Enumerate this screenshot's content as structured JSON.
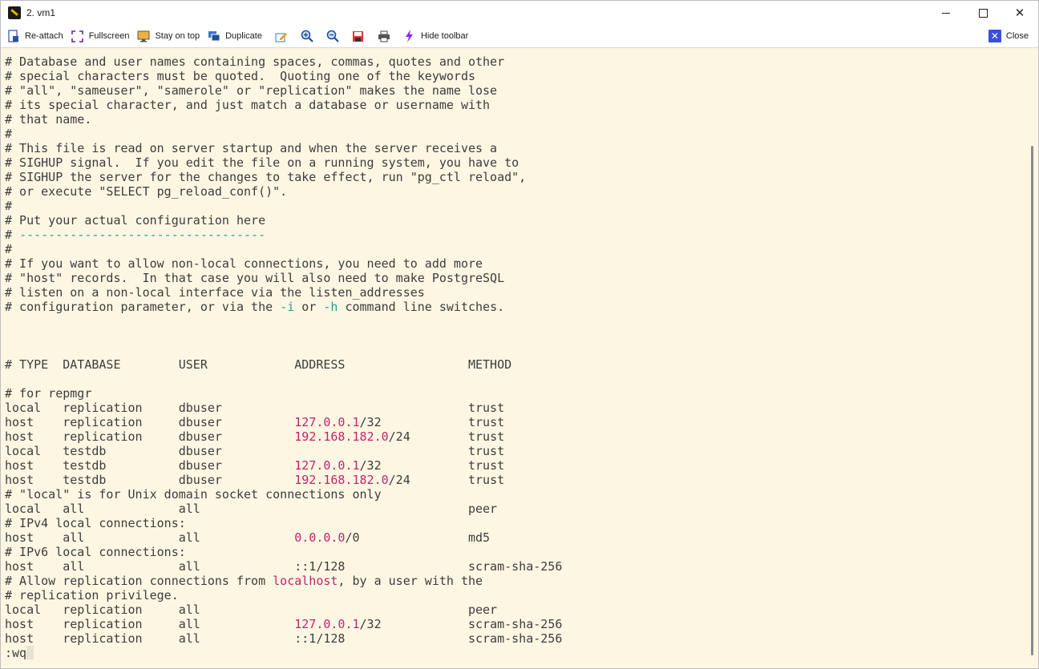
{
  "window": {
    "title": "2. vm1"
  },
  "toolbar": {
    "reattach": "Re-attach",
    "fullscreen": "Fullscreen",
    "stay_on_top": "Stay on top",
    "duplicate": "Duplicate",
    "hide_toolbar": "Hide toolbar",
    "close": "Close"
  },
  "terminal": {
    "lines": [
      "# Database and user names containing spaces, commas, quotes and other",
      "# special characters must be quoted.  Quoting one of the keywords",
      "# \"all\", \"sameuser\", \"samerole\" or \"replication\" makes the name lose",
      "# its special character, and just match a database or username with",
      "# that name.",
      "#",
      "# This file is read on server startup and when the server receives a",
      "# SIGHUP signal.  If you edit the file on a running system, you have to",
      "# SIGHUP the server for the changes to take effect, run \"pg_ctl reload\",",
      "# or execute \"SELECT pg_reload_conf()\".",
      "#",
      "# Put your actual configuration here",
      "# ----------------------------------",
      "#",
      "# If you want to allow non-local connections, you need to add more",
      "# \"host\" records.  In that case you will also need to make PostgreSQL",
      "# listen on a non-local interface via the listen_addresses",
      "# configuration parameter, or via the -i or -h command line switches.",
      "",
      "",
      "",
      "# TYPE  DATABASE        USER            ADDRESS                 METHOD",
      "",
      "# for repmgr",
      "local   replication     dbuser                                  trust",
      "host    replication     dbuser          127.0.0.1/32            trust",
      "host    replication     dbuser          192.168.182.0/24        trust",
      "local   testdb          dbuser                                  trust",
      "host    testdb          dbuser          127.0.0.1/32            trust",
      "host    testdb          dbuser          192.168.182.0/24        trust",
      "# \"local\" is for Unix domain socket connections only",
      "local   all             all                                     peer",
      "# IPv4 local connections:",
      "host    all             all             0.0.0.0/0               md5",
      "# IPv6 local connections:",
      "host    all             all             ::1/128                 scram-sha-256",
      "# Allow replication connections from localhost, by a user with the",
      "# replication privilege.",
      "local   replication     all                                     peer",
      "host    replication     all             127.0.0.1/32            scram-sha-256",
      "host    replication     all             ::1/128                 scram-sha-256"
    ],
    "command": ":wq"
  },
  "colors": {
    "background": "#fdf6e3",
    "text": "#3d3d3d",
    "ip_highlight": "#c3246b",
    "flag_highlight": "#2a9d8f",
    "close_accent": "#3b4fd8"
  },
  "icons": {
    "reattach": "reattach-icon",
    "fullscreen": "fullscreen-icon",
    "stay_on_top": "monitor-icon",
    "duplicate": "duplicate-icon",
    "edit": "edit-icon",
    "zoom_in": "zoom-in-icon",
    "zoom_out": "zoom-out-icon",
    "save": "save-icon",
    "print": "print-icon",
    "hide_toolbar": "lightning-icon",
    "close": "close-icon"
  }
}
